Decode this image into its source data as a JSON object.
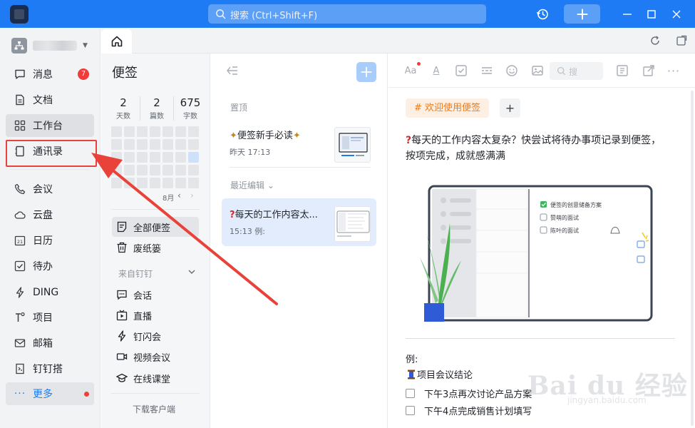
{
  "titlebar": {
    "search_placeholder": "搜索 (Ctrl+Shift+F)"
  },
  "nav": {
    "items": [
      {
        "label": "消息",
        "icon": "message-icon",
        "badge": "7"
      },
      {
        "label": "文档",
        "icon": "document-icon"
      },
      {
        "label": "工作台",
        "icon": "grid-icon"
      },
      {
        "label": "通讯录",
        "icon": "contacts-icon"
      },
      {
        "label": "会议",
        "icon": "phone-icon"
      },
      {
        "label": "云盘",
        "icon": "cloud-icon"
      },
      {
        "label": "日历",
        "icon": "calendar-icon",
        "icon_text": "21"
      },
      {
        "label": "待办",
        "icon": "checkbox-icon"
      },
      {
        "label": "DING",
        "icon": "lightning-icon"
      },
      {
        "label": "项目",
        "icon": "project-icon"
      },
      {
        "label": "邮箱",
        "icon": "mail-icon"
      },
      {
        "label": "钉钉搭",
        "icon": "builder-icon"
      },
      {
        "label": "更多",
        "icon": "more-icon"
      }
    ]
  },
  "notes_sidebar": {
    "title": "便签",
    "stats": [
      {
        "value": "2",
        "label": "天数"
      },
      {
        "value": "2",
        "label": "篇数"
      },
      {
        "value": "675",
        "label": "字数"
      }
    ],
    "calendar_month": "8月",
    "items": [
      {
        "label": "全部便签"
      },
      {
        "label": "废纸篓"
      }
    ],
    "group_label": "来自钉钉",
    "group_items": [
      {
        "label": "会话"
      },
      {
        "label": "直播"
      },
      {
        "label": "钉闪会"
      },
      {
        "label": "视频会议"
      },
      {
        "label": "在线课堂"
      }
    ],
    "download_label": "下载客户端"
  },
  "notes_list": {
    "pinned_label": "置顶",
    "recent_label": "最近编辑",
    "notes": [
      {
        "title": "便签新手必读",
        "meta": "昨天 17:13"
      },
      {
        "title": "每天的工作内容太...",
        "meta": "15:13 例:"
      }
    ]
  },
  "editor": {
    "search_placeholder": "搜",
    "tag_label": "# 欢迎使用便签",
    "paragraph": "每天的工作内容太复杂？快尝试将待办事项记录到便签，按项完成，成就感满满",
    "illustration": {
      "items": [
        "便签的创意储备方案",
        "赞萌的面试",
        "陈叶的面试"
      ]
    },
    "example_label": "例:",
    "example_title": "项目会议结论",
    "todos": [
      "下午3点再次讨论产品方案",
      "下午4点完成销售计划填写"
    ]
  },
  "watermark": {
    "brand": "Bai du 经验",
    "sub": "jingyan.baidu.com"
  },
  "colors": {
    "titlebar": "#1e7bf3",
    "accent": "#1e7bf3",
    "badge": "#f33b3b",
    "tag_text": "#ee7a1a",
    "tag_bg": "#fdf0e3",
    "annotation": "#e8423a"
  }
}
